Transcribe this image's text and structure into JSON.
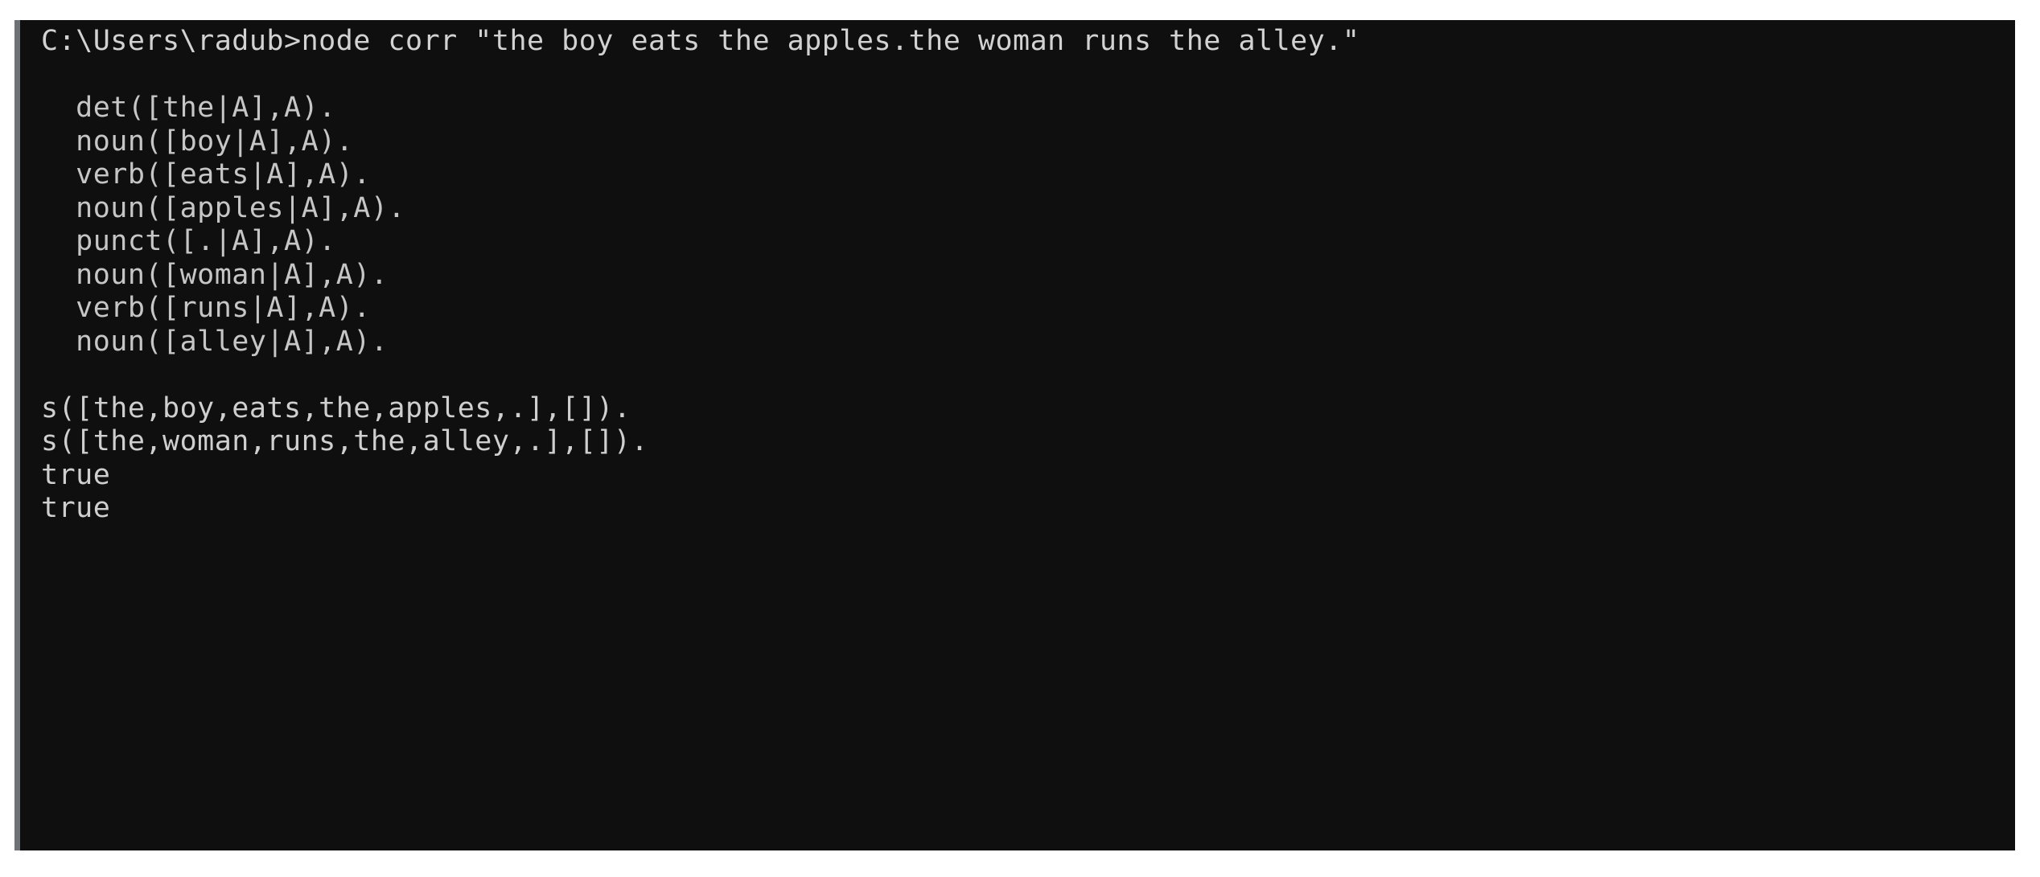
{
  "window": {
    "title": "Command Prompt",
    "background_color": "#100f0f",
    "text_color": "#c9c9c9",
    "page_background_color": "#ffffff",
    "left_rail_color": "#6e7175"
  },
  "console": {
    "prompt": {
      "path": "C:\\Users\\radub",
      "symbol": ">",
      "command": "node corr \"the boy eats the apples.the woman runs the alley.\"",
      "full_line": "C:\\Users\\radub>node corr \"the boy eats the apples.the woman runs the alley.\""
    },
    "lines": [
      {
        "id": "prompt-line",
        "kind": "prompt",
        "text": "C:\\Users\\radub>node corr \"the boy eats the apples.the woman runs the alley.\""
      },
      {
        "id": "blank-1",
        "kind": "blank",
        "text": " "
      },
      {
        "id": "fact-det-the",
        "kind": "indented",
        "text": "  det([the|A],A)."
      },
      {
        "id": "fact-noun-boy",
        "kind": "indented",
        "text": "  noun([boy|A],A)."
      },
      {
        "id": "fact-verb-eats",
        "kind": "indented",
        "text": "  verb([eats|A],A)."
      },
      {
        "id": "fact-noun-apples",
        "kind": "indented",
        "text": "  noun([apples|A],A)."
      },
      {
        "id": "fact-punct-period",
        "kind": "indented",
        "text": "  punct([.|A],A)."
      },
      {
        "id": "fact-noun-woman",
        "kind": "indented",
        "text": "  noun([woman|A],A)."
      },
      {
        "id": "fact-verb-runs",
        "kind": "indented",
        "text": "  verb([runs|A],A)."
      },
      {
        "id": "fact-noun-alley",
        "kind": "indented",
        "text": "  noun([alley|A],A)."
      },
      {
        "id": "blank-2",
        "kind": "blank",
        "text": " "
      },
      {
        "id": "clause-sentence-1",
        "kind": "clause",
        "text": "s([the,boy,eats,the,apples,.],[])."
      },
      {
        "id": "clause-sentence-2",
        "kind": "clause",
        "text": "s([the,woman,runs,the,alley,.],[])."
      },
      {
        "id": "result-true-1",
        "kind": "result",
        "text": "true"
      },
      {
        "id": "result-true-2",
        "kind": "result",
        "text": "true"
      }
    ]
  }
}
